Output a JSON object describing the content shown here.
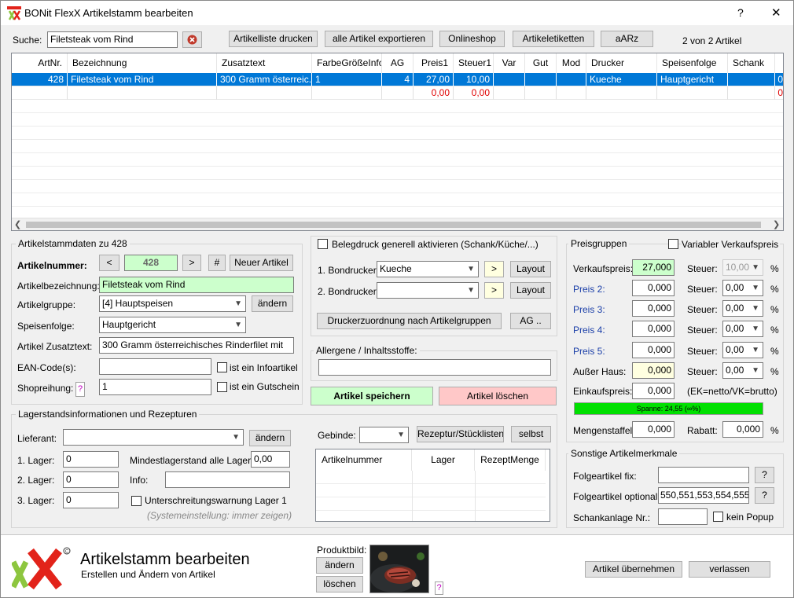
{
  "window": {
    "title": "BONit FlexX Artikelstamm bearbeiten",
    "help_label": "?",
    "close_label": "✕"
  },
  "toolbar": {
    "search_label": "Suche:",
    "search_value": "Filetsteak vom Rind",
    "btn_print": "Artikelliste drucken",
    "btn_export": "alle Artikel exportieren",
    "btn_online": "Onlineshop",
    "btn_labels": "Artikeletiketten",
    "btn_aarz": "aARz",
    "count": "2 von 2 Artikel"
  },
  "grid": {
    "headers": [
      "ArtNr.",
      "Bezeichnung",
      "Zusatztext",
      "FarbeGrößeInfo",
      "AG",
      "Preis1",
      "Steuer1",
      "Var",
      "Gut",
      "Mod",
      "Drucker",
      "Speisenfolge",
      "Schank"
    ],
    "row1": {
      "artnr": "428",
      "bez": "Filetsteak vom Rind",
      "zusatz": "300 Gramm österreic...",
      "farbe": "1",
      "ag": "4",
      "preis": "27,00",
      "steuer": "10,00",
      "drucker": "Kueche",
      "speise": "Hauptgericht",
      "extra": "0"
    },
    "row2": {
      "preis": "0,00",
      "steuer": "0,00",
      "extra": "0"
    }
  },
  "stamm": {
    "title": "Artikelstammdaten zu 428",
    "artnr_label": "Artikelnummer:",
    "prev": "<",
    "artnr_value": "428",
    "next": ">",
    "hash": "#",
    "new_article": "Neuer Artikel",
    "bez_label": "Artikelbezeichnung:",
    "bez_value": "Filetsteak vom Rind",
    "gruppe_label": "Artikelgruppe:",
    "gruppe_value": "[4] Hauptspeisen",
    "aendern": "ändern",
    "speise_label": "Speisenfolge:",
    "speise_value": "Hauptgericht",
    "zusatz_label": "Artikel Zusatztext:",
    "zusatz_value": "300 Gramm österreichisches Rinderfilet mit",
    "ean_label": "EAN-Code(s):",
    "ean_value": "",
    "info_chk": "ist ein Infoartikel",
    "shop_label": "Shopreihung:",
    "shop_help": "?",
    "shop_value": "1",
    "gutschein_chk": "ist ein Gutschein"
  },
  "bon": {
    "beleg_chk": "Belegdruck generell aktivieren (Schank/Küche/...)",
    "bon1_label": "1. Bondrucker:",
    "bon1_value": "Kueche",
    "bon2_label": "2. Bondrucker:",
    "bon2_value": "",
    "arrow": ">",
    "layout": "Layout",
    "zuordnung": "Druckerzuordnung nach Artikelgruppen",
    "ag": "AG ..",
    "allergene": "Allergene / Inhaltsstoffe:",
    "allergene_value": "",
    "speichern": "Artikel speichern",
    "loeschen": "Artikel löschen"
  },
  "preise": {
    "title": "Preisgruppen",
    "variabel": "Variabler Verkaufspreis",
    "vk_label": "Verkaufspreis:",
    "vk_value": "27,000",
    "steuer_label": "Steuer:",
    "steuer1": "10,00",
    "p2_label": "Preis 2:",
    "p2": "0,000",
    "steuer2": "0,00",
    "p3_label": "Preis 3:",
    "p3": "0,000",
    "steuer3": "0,00",
    "p4_label": "Preis 4:",
    "p4": "0,000",
    "steuer4": "0,00",
    "p5_label": "Preis 5:",
    "p5": "0,000",
    "steuer5": "0,00",
    "ausser_label": "Außer Haus:",
    "ausser": "0,000",
    "steuer6": "0,00",
    "pct": "%",
    "ek_label": "Einkaufspreis:",
    "ek": "0,000",
    "ek_hint": "(EK=netto/VK=brutto)",
    "spanne": "Spanne: 24,55 (∞%)",
    "spanne_fraction": 1.0,
    "menge_label": "Mengenstaffel:",
    "menge": "0,000",
    "rabatt_label": "Rabatt:",
    "rabatt": "0,000"
  },
  "lager": {
    "title": "Lagerstandsinformationen und Rezepturen",
    "lieferant_label": "Lieferant:",
    "lieferant_value": "",
    "aendern": "ändern",
    "l1_label": "1. Lager:",
    "l1": "0",
    "l2_label": "2. Lager:",
    "l2": "0",
    "l3_label": "3. Lager:",
    "l3": "0",
    "min_label": "Mindestlagerstand alle Lager:",
    "min_value": "0,00",
    "info_label": "Info:",
    "info_value": "",
    "warn_chk": "Unterschreitungswarnung Lager 1",
    "sys_hint": "(Systemeinstellung: immer zeigen)",
    "gebinde_label": "Gebinde:",
    "rezeptur": "Rezeptur/Stücklisten",
    "selbst": "selbst",
    "col_art": "Artikelnummer",
    "col_lager": "Lager",
    "col_menge": "RezeptMenge"
  },
  "sonstige": {
    "title": "Sonstige Artikelmerkmale",
    "fix_label": "Folgeartikel fix:",
    "fix_value": "",
    "opt_label": "Folgeartikel optional:",
    "opt_value": "550,551,553,554,555,5",
    "help": "?",
    "schank_label": "Schankanlage Nr.:",
    "schank_value": "",
    "popup": "kein Popup"
  },
  "footer": {
    "title": "Artikelstamm bearbeiten",
    "subtitle": "Erstellen und Ändern von Artikel",
    "produktbild": "Produktbild:",
    "aendern": "ändern",
    "loeschen": "löschen",
    "help": "?",
    "uebernehmen": "Artikel übernehmen",
    "verlassen": "verlassen"
  },
  "colors": {
    "selection": "#0078d7",
    "green_field": "#ccffcc",
    "yellow_field": "#ffffe0",
    "logo_red": "#e2231a",
    "logo_green": "#8dc63f",
    "spanne_green": "#00e000"
  }
}
